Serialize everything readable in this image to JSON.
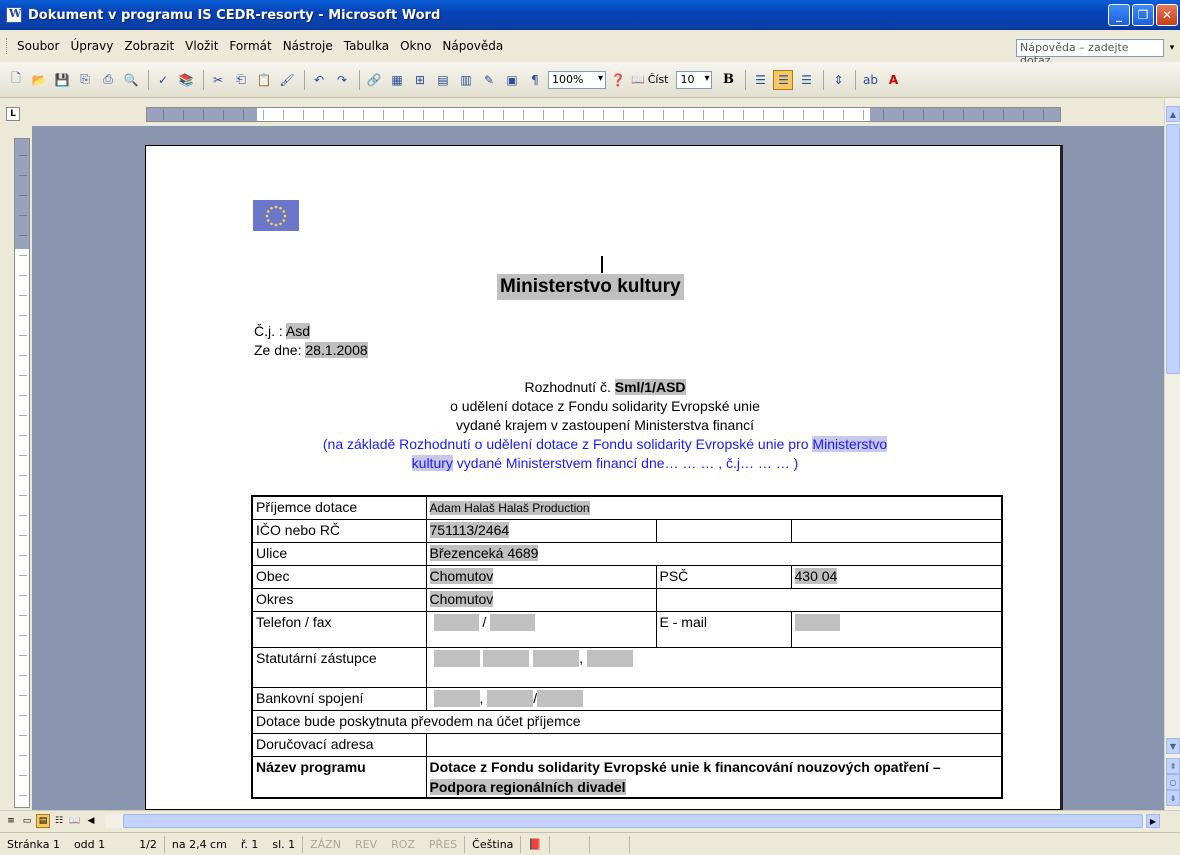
{
  "window": {
    "title": "Dokument v programu IS CEDR-resorty - Microsoft Word",
    "buttons": {
      "minimize": "_",
      "maximize": "❐",
      "close": "✕"
    }
  },
  "menu": {
    "items": [
      "Soubor",
      "Úpravy",
      "Zobrazit",
      "Vložit",
      "Formát",
      "Nástroje",
      "Tabulka",
      "Okno",
      "Nápověda"
    ],
    "help_placeholder": "Nápověda – zadejte dotaz"
  },
  "toolbar": {
    "zoom": "100%",
    "read_label": "Číst",
    "font_size": "10",
    "bold_label": "B"
  },
  "document": {
    "heading": "Ministerstvo kultury",
    "cj_label": "Č.j. : ",
    "cj_value": "Asd",
    "date_label": "Ze dne: ",
    "date_value": "28.1.2008",
    "decision_label": "Rozhodnutí č.  ",
    "decision_number": "Sml/1/ASD",
    "line2": "o udělení dotace  z Fondu solidarity Evropské unie",
    "line3": "vydané krajem v zastoupení Ministerstva financí",
    "blue_line_a": "(na základě Rozhodnutí o udělení dotace z Fondu solidarity Evropské unie pro ",
    "blue_hl_a": "Ministerstvo",
    "blue_hl_b": "kultury",
    "blue_line_b": " vydané Ministerstvem financí dne… … … , č.j… … … )"
  },
  "form": {
    "prijemce_label": "Příjemce dotace",
    "prijemce_value": "Adam Halaš Halaš Production",
    "ico_label": "IČO nebo RČ",
    "ico_value": "751113/2464",
    "ulice_label": "Ulice",
    "ulice_value": "Březenceká 4689",
    "obec_label": "Obec",
    "obec_value": "Chomutov",
    "psc_label": "PSČ",
    "psc_value": "430 04",
    "okres_label": "Okres",
    "okres_value": "Chomutov",
    "telefon_label": "Telefon / fax",
    "telefon_sep": "/",
    "email_label": "E - mail",
    "statutar_label": "Statutární zástupce",
    "statutar_sep": ",",
    "bank_label": "Bankovní spojení",
    "bank_sep1": ",",
    "bank_sep2": "/",
    "dotace_text": "Dotace bude poskytnuta  převodem na účet příjemce",
    "dorucovaci_label": "Doručovací adresa",
    "program_label": "Název programu",
    "program_value_a": "Dotace z Fondu solidarity Evropské unie k financování nouzových opatření – ",
    "program_value_b": "Podpora regionálních divadel"
  },
  "statusbar": {
    "page": "Stránka 1",
    "section": "odd 1",
    "pages": "1/2",
    "position": "na 2,4 cm",
    "line": "ř. 1",
    "column": "sl. 1",
    "rec": "ZÁZN",
    "rev": "REV",
    "ext": "ROZ",
    "ovr": "PŘES",
    "language": "Čeština"
  }
}
